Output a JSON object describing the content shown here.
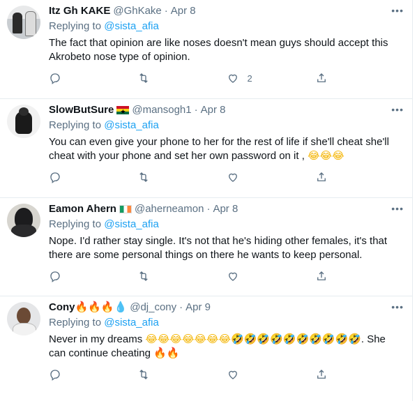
{
  "replying_label": "Replying to",
  "tweets": [
    {
      "name": "Itz Gh KAKE",
      "name_suffix": "",
      "handle": "@GhKake",
      "date": "Apr 8",
      "reply_to": "@sista_afia",
      "text": "The fact that opinion are like noses doesn't mean guys should accept this Akrobeto nose type of opinion.",
      "like_count": "2"
    },
    {
      "name": "SlowButSure",
      "flag": "ghana-flag",
      "handle": "@mansogh1",
      "date": "Apr 8",
      "reply_to": "@sista_afia",
      "text": "You can even give your phone to her for the rest of life if she'll cheat she'll cheat with your phone and set her own password on it ,",
      "text_emoji": "😂😂😂",
      "like_count": ""
    },
    {
      "name": "Eamon Ahern",
      "flag": "ireland-flag",
      "handle": "@aherneamon",
      "date": "Apr 8",
      "reply_to": "@sista_afia",
      "text": "Nope. I'd rather stay single. It's not that he's hiding other females, it's that there are some personal things on there he wants to keep personal.",
      "like_count": ""
    },
    {
      "name": "Cony",
      "name_emoji": "🔥🔥🔥",
      "name_drop": "💧",
      "handle": "@dj_cony",
      "date": "Apr 9",
      "reply_to": "@sista_afia",
      "text_prefix": "Never in my dreams",
      "text_emoji_laugh": "😂😂😂😂😂😂😂",
      "text_emoji_rofl": "🤣🤣🤣🤣🤣🤣🤣🤣🤣🤣",
      "text_suffix": ". She can continue cheating",
      "text_fire": "🔥🔥",
      "like_count": ""
    }
  ],
  "icons": {
    "more": "more-icon",
    "reply": "reply-icon",
    "retweet": "retweet-icon",
    "like": "like-icon",
    "share": "share-icon"
  },
  "colors": {
    "link": "#1da1f2",
    "secondary": "#5b7083",
    "divider": "#e6ecf0"
  }
}
